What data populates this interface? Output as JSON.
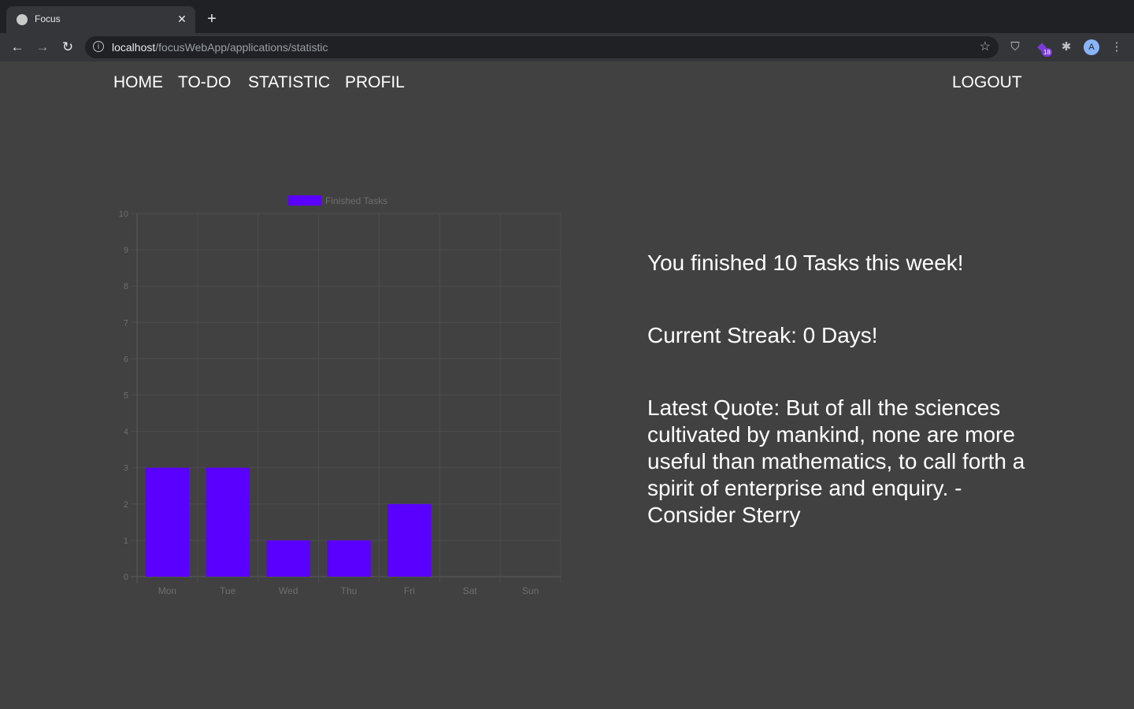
{
  "browser": {
    "tab_title": "Focus",
    "url_host": "localhost",
    "url_path": "/focusWebApp/applications/statistic",
    "extension_badge": "18",
    "profile_initial": "A",
    "icons": [
      "back-icon",
      "forward-icon",
      "reload-icon",
      "info-icon",
      "star-icon",
      "shield-icon",
      "puzzle-icon",
      "menu-icon"
    ]
  },
  "nav": {
    "home": "HOME",
    "todo": "TO-DO",
    "statistic": "STATISTIC",
    "profil": "PROFIL",
    "logout": "LOGOUT"
  },
  "stats": {
    "finished": "You finished 10 Tasks this week!",
    "streak": "Current Streak: 0 Days!",
    "quote": "Latest Quote: But of all the sciences cultivated by mankind, none are more useful than mathematics, to call forth a spirit of enterprise and enquiry. - Consider Sterry"
  },
  "colors": {
    "page_bg": "#414141",
    "bar": "#5a00ff",
    "grid": "#4d4d4d",
    "axis_text": "#6e6e6e"
  },
  "chart_data": {
    "type": "bar",
    "categories": [
      "Mon",
      "Tue",
      "Wed",
      "Thu",
      "Fri",
      "Sat",
      "Sun"
    ],
    "series": [
      {
        "name": "Finished Tasks",
        "values": [
          3,
          3,
          1,
          1,
          2,
          0,
          0
        ]
      }
    ],
    "ylim": [
      0,
      10
    ],
    "yticks": [
      0,
      1,
      2,
      3,
      4,
      5,
      6,
      7,
      8,
      9,
      10
    ],
    "legend": "top",
    "grid": true
  }
}
